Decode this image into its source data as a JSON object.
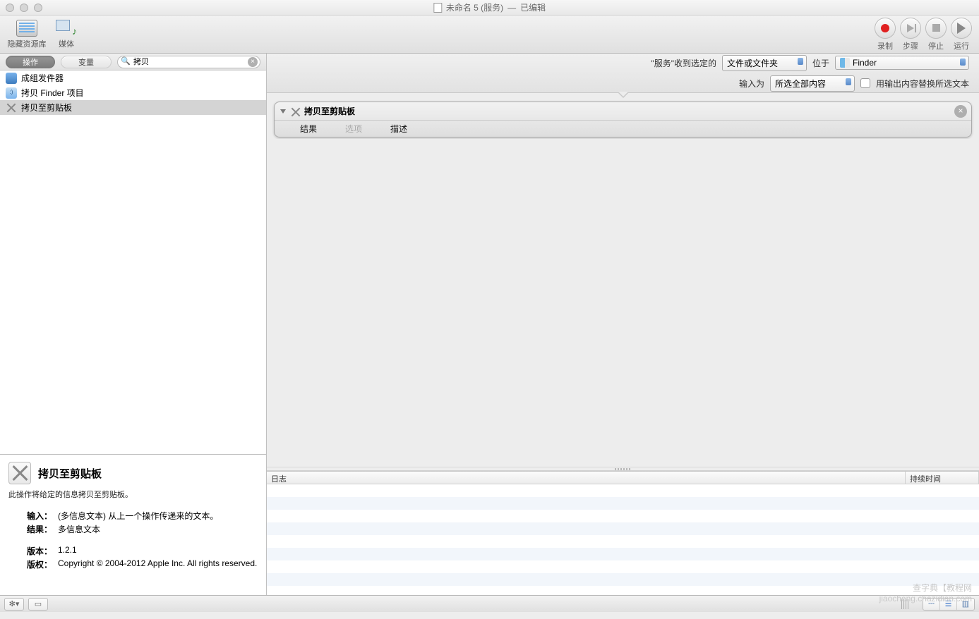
{
  "window": {
    "title": "未命名 5 (服务)",
    "edited": "已编辑"
  },
  "toolbar": {
    "hide_library": "隐藏资源库",
    "media": "媒体",
    "record": "录制",
    "step": "步骤",
    "stop": "停止",
    "run": "运行"
  },
  "sidebar": {
    "tab_actions": "操作",
    "tab_vars": "变量",
    "search_value": "拷贝",
    "items": [
      {
        "label": "成组发件器"
      },
      {
        "label": "拷贝 Finder 项目"
      },
      {
        "label": "拷贝至剪贴板"
      }
    ]
  },
  "info": {
    "title": "拷贝至剪贴板",
    "desc": "此操作将给定的信息拷贝至剪贴板。",
    "input_label": "输入：",
    "input_value": "(多信息文本) 从上一个操作传递来的文本。",
    "result_label": "结果：",
    "result_value": "多信息文本",
    "version_label": "版本：",
    "version_value": "1.2.1",
    "copyright_label": "版权：",
    "copyright_value": "Copyright © 2004-2012 Apple Inc.  All rights reserved."
  },
  "service": {
    "receives_label": "\"服务\"收到选定的",
    "receives_value": "文件或文件夹",
    "in_label": "位于",
    "in_value": "Finder",
    "input_as_label": "输入为",
    "input_as_value": "所选全部内容",
    "replace_label": "用输出内容替换所选文本"
  },
  "action": {
    "title": "拷贝至剪贴板",
    "tab_results": "结果",
    "tab_options": "选项",
    "tab_desc": "描述"
  },
  "log": {
    "col_log": "日志",
    "col_duration": "持续时间"
  },
  "watermark": {
    "l1": "查字典【教程网",
    "l2": "jiaocheng.chazidian.com"
  }
}
